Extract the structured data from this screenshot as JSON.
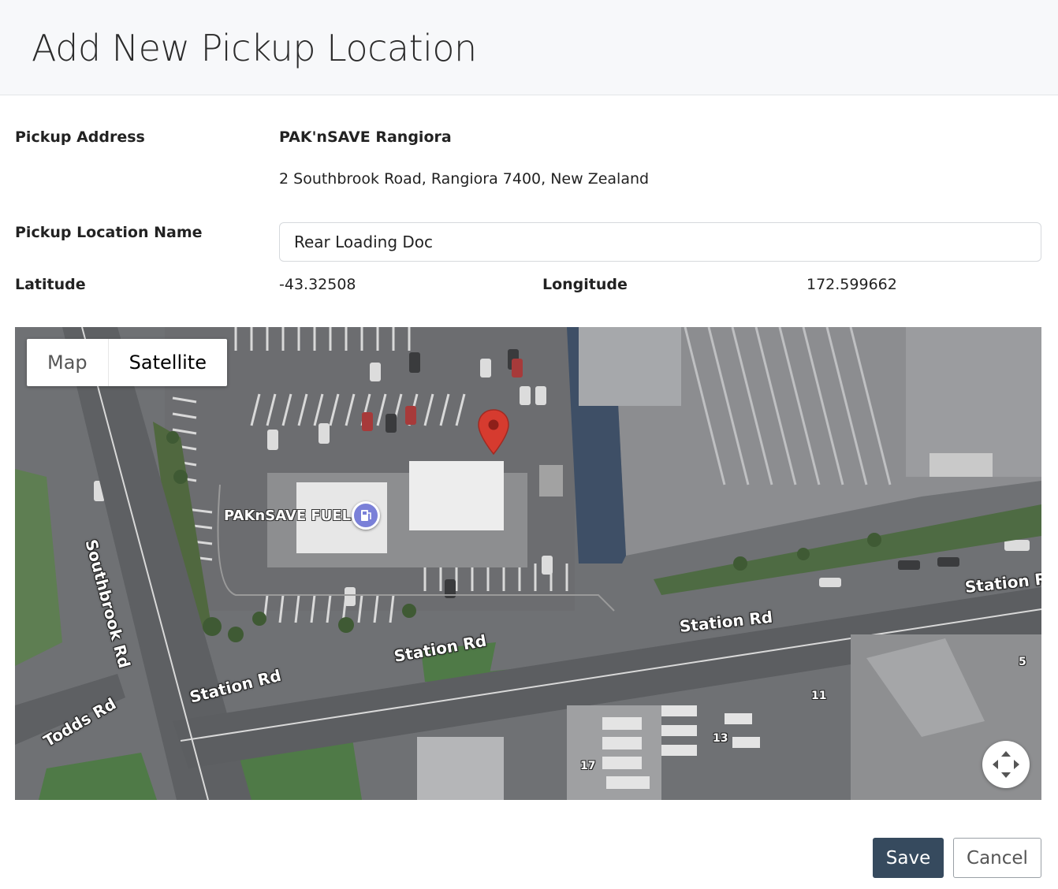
{
  "header": {
    "title": "Add New Pickup Location"
  },
  "form": {
    "pickup_address_label": "Pickup Address",
    "address_name": "PAK'nSAVE Rangiora",
    "address_line": "2 Southbrook Road, Rangiora 7400, New Zealand",
    "location_name_label": "Pickup Location Name",
    "location_name_value": "Rear Loading Doc",
    "latitude_label": "Latitude",
    "latitude_value": "-43.32508",
    "longitude_label": "Longitude",
    "longitude_value": "172.599662"
  },
  "map": {
    "type_options": [
      "Map",
      "Satellite"
    ],
    "selected_type": "Satellite",
    "poi_label": "PAKnSAVE FUEL",
    "streets": [
      "Southbrook Rd",
      "Station Rd",
      "Station Rd",
      "Station Rd",
      "Station Rd",
      "Todds Rd"
    ],
    "numbers": [
      "5",
      "11",
      "13",
      "17"
    ],
    "icons": {
      "marker": "map-pin-icon",
      "poi": "fuel-icon",
      "fullscreen": "move-arrows-icon"
    }
  },
  "actions": {
    "save_label": "Save",
    "cancel_label": "Cancel"
  },
  "colors": {
    "save_bg": "#364a5e",
    "pin": "#d63b2f",
    "poi": "#7a80d8"
  }
}
